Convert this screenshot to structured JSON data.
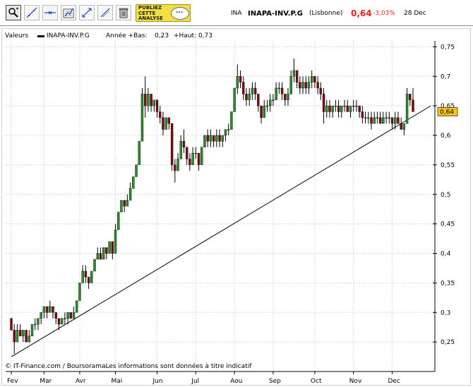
{
  "toolbar": {
    "tools": [
      {
        "name": "zoom-tool-icon",
        "active": true
      },
      {
        "name": "trend-line-tool-icon",
        "active": false
      },
      {
        "name": "horizontal-line-tool-icon",
        "active": false
      },
      {
        "name": "indicator-tool-icon",
        "active": false
      },
      {
        "name": "arrows-tool-icon",
        "active": false
      },
      {
        "name": "fibonacci-tool-icon",
        "active": false
      },
      {
        "name": "trash-tool-icon",
        "active": false
      }
    ],
    "promo": [
      "PUBLIEZ",
      "CETTE",
      "ANALYSE"
    ]
  },
  "quote": {
    "code": "INA",
    "name": "INAPA-INV.P.G",
    "market": "(Lisbonne)",
    "price": "0,64",
    "change": "-3,03%",
    "date": "28 Dec"
  },
  "legend": {
    "caption": "Valeurs",
    "series": "INAPA-INV.P.G",
    "range_label": "Année +Bas:",
    "low": "0,23",
    "high": "+Haut: 0,73"
  },
  "footer": {
    "credit": "© IT-Finance.com / BoursoramaLes informations sont données à titre indicatif"
  },
  "colors": {
    "up": "#2e8b2e",
    "down": "#7a0e0e",
    "wick": "#000000",
    "grid": "#c8c8c8",
    "last_price_box": "#f5c518"
  },
  "chart_data": {
    "type": "candlestick",
    "ylim": [
      0.2,
      0.76
    ],
    "y_ticks": [
      0.25,
      0.3,
      0.35,
      0.4,
      0.45,
      0.5,
      0.55,
      0.6,
      0.65,
      0.7,
      0.75
    ],
    "y_tick_labels": [
      "0,25",
      "0,3",
      "0,35",
      "0,4",
      "0,45",
      "0,5",
      "0,55",
      "0,6",
      "0,65",
      "0,7",
      "0,75"
    ],
    "x_ticks": [
      "Fev",
      "Mar",
      "Avr",
      "Mai",
      "Jun",
      "Jul",
      "Aou",
      "Sep",
      "Oct",
      "Nov",
      "Dec"
    ],
    "x_tick_index": [
      0,
      11,
      23,
      35,
      49,
      62,
      75,
      88,
      102,
      115,
      128
    ],
    "last_price": 0.64,
    "last_price_label": "0,64",
    "grid": true,
    "trend_line": {
      "start_index": 0,
      "start_value": 0.225,
      "end_index": 141,
      "end_value": 0.65
    },
    "candles": [
      [
        0.29,
        0.29,
        0.27,
        0.27
      ],
      [
        0.27,
        0.28,
        0.23,
        0.25
      ],
      [
        0.25,
        0.28,
        0.25,
        0.27
      ],
      [
        0.27,
        0.28,
        0.26,
        0.26
      ],
      [
        0.26,
        0.27,
        0.25,
        0.27
      ],
      [
        0.27,
        0.27,
        0.25,
        0.25
      ],
      [
        0.25,
        0.27,
        0.25,
        0.26
      ],
      [
        0.26,
        0.28,
        0.26,
        0.28
      ],
      [
        0.28,
        0.29,
        0.27,
        0.28
      ],
      [
        0.28,
        0.29,
        0.27,
        0.29
      ],
      [
        0.29,
        0.3,
        0.28,
        0.3
      ],
      [
        0.3,
        0.31,
        0.29,
        0.31
      ],
      [
        0.31,
        0.31,
        0.29,
        0.3
      ],
      [
        0.3,
        0.32,
        0.3,
        0.31
      ],
      [
        0.31,
        0.31,
        0.29,
        0.3
      ],
      [
        0.3,
        0.3,
        0.28,
        0.29
      ],
      [
        0.29,
        0.29,
        0.27,
        0.28
      ],
      [
        0.28,
        0.29,
        0.28,
        0.29
      ],
      [
        0.29,
        0.3,
        0.28,
        0.29
      ],
      [
        0.29,
        0.3,
        0.28,
        0.3
      ],
      [
        0.3,
        0.3,
        0.29,
        0.29
      ],
      [
        0.29,
        0.31,
        0.29,
        0.3
      ],
      [
        0.3,
        0.32,
        0.3,
        0.32
      ],
      [
        0.32,
        0.35,
        0.32,
        0.35
      ],
      [
        0.35,
        0.38,
        0.35,
        0.37
      ],
      [
        0.37,
        0.38,
        0.35,
        0.36
      ],
      [
        0.36,
        0.36,
        0.34,
        0.35
      ],
      [
        0.35,
        0.37,
        0.35,
        0.37
      ],
      [
        0.37,
        0.39,
        0.37,
        0.39
      ],
      [
        0.39,
        0.41,
        0.39,
        0.4
      ],
      [
        0.4,
        0.41,
        0.39,
        0.39
      ],
      [
        0.39,
        0.41,
        0.39,
        0.41
      ],
      [
        0.41,
        0.41,
        0.39,
        0.4
      ],
      [
        0.4,
        0.42,
        0.4,
        0.42
      ],
      [
        0.42,
        0.42,
        0.39,
        0.4
      ],
      [
        0.4,
        0.45,
        0.4,
        0.44
      ],
      [
        0.44,
        0.47,
        0.44,
        0.47
      ],
      [
        0.47,
        0.49,
        0.47,
        0.49
      ],
      [
        0.49,
        0.49,
        0.47,
        0.48
      ],
      [
        0.48,
        0.5,
        0.48,
        0.49
      ],
      [
        0.49,
        0.52,
        0.49,
        0.51
      ],
      [
        0.51,
        0.53,
        0.51,
        0.53
      ],
      [
        0.53,
        0.55,
        0.53,
        0.55
      ],
      [
        0.55,
        0.59,
        0.55,
        0.59
      ],
      [
        0.59,
        0.68,
        0.59,
        0.67
      ],
      [
        0.67,
        0.7,
        0.63,
        0.65
      ],
      [
        0.65,
        0.68,
        0.64,
        0.67
      ],
      [
        0.67,
        0.67,
        0.64,
        0.65
      ],
      [
        0.65,
        0.66,
        0.64,
        0.66
      ],
      [
        0.66,
        0.66,
        0.63,
        0.64
      ],
      [
        0.64,
        0.65,
        0.62,
        0.63
      ],
      [
        0.63,
        0.64,
        0.6,
        0.61
      ],
      [
        0.61,
        0.63,
        0.61,
        0.63
      ],
      [
        0.63,
        0.63,
        0.61,
        0.62
      ],
      [
        0.62,
        0.62,
        0.54,
        0.55
      ],
      [
        0.55,
        0.56,
        0.52,
        0.54
      ],
      [
        0.54,
        0.57,
        0.54,
        0.56
      ],
      [
        0.56,
        0.6,
        0.56,
        0.59
      ],
      [
        0.59,
        0.61,
        0.57,
        0.58
      ],
      [
        0.58,
        0.58,
        0.55,
        0.56
      ],
      [
        0.56,
        0.57,
        0.54,
        0.55
      ],
      [
        0.55,
        0.58,
        0.55,
        0.57
      ],
      [
        0.57,
        0.58,
        0.56,
        0.57
      ],
      [
        0.57,
        0.57,
        0.54,
        0.55
      ],
      [
        0.55,
        0.58,
        0.55,
        0.58
      ],
      [
        0.58,
        0.6,
        0.58,
        0.6
      ],
      [
        0.6,
        0.61,
        0.58,
        0.59
      ],
      [
        0.59,
        0.61,
        0.58,
        0.6
      ],
      [
        0.6,
        0.6,
        0.58,
        0.59
      ],
      [
        0.59,
        0.61,
        0.58,
        0.6
      ],
      [
        0.6,
        0.61,
        0.58,
        0.59
      ],
      [
        0.59,
        0.6,
        0.58,
        0.6
      ],
      [
        0.6,
        0.61,
        0.59,
        0.61
      ],
      [
        0.61,
        0.62,
        0.6,
        0.61
      ],
      [
        0.61,
        0.64,
        0.61,
        0.64
      ],
      [
        0.64,
        0.68,
        0.64,
        0.68
      ],
      [
        0.68,
        0.72,
        0.67,
        0.7
      ],
      [
        0.7,
        0.71,
        0.68,
        0.69
      ],
      [
        0.69,
        0.7,
        0.66,
        0.67
      ],
      [
        0.67,
        0.68,
        0.65,
        0.66
      ],
      [
        0.66,
        0.68,
        0.65,
        0.67
      ],
      [
        0.67,
        0.69,
        0.66,
        0.68
      ],
      [
        0.68,
        0.69,
        0.66,
        0.67
      ],
      [
        0.67,
        0.67,
        0.64,
        0.65
      ],
      [
        0.65,
        0.65,
        0.62,
        0.63
      ],
      [
        0.63,
        0.66,
        0.63,
        0.65
      ],
      [
        0.65,
        0.66,
        0.64,
        0.65
      ],
      [
        0.65,
        0.67,
        0.64,
        0.66
      ],
      [
        0.66,
        0.67,
        0.65,
        0.66
      ],
      [
        0.66,
        0.69,
        0.66,
        0.68
      ],
      [
        0.68,
        0.69,
        0.67,
        0.68
      ],
      [
        0.68,
        0.69,
        0.66,
        0.67
      ],
      [
        0.67,
        0.67,
        0.65,
        0.66
      ],
      [
        0.66,
        0.68,
        0.65,
        0.67
      ],
      [
        0.67,
        0.71,
        0.67,
        0.7
      ],
      [
        0.7,
        0.73,
        0.69,
        0.71
      ],
      [
        0.71,
        0.71,
        0.68,
        0.69
      ],
      [
        0.69,
        0.7,
        0.67,
        0.68
      ],
      [
        0.68,
        0.7,
        0.67,
        0.69
      ],
      [
        0.69,
        0.7,
        0.67,
        0.68
      ],
      [
        0.68,
        0.7,
        0.67,
        0.69
      ],
      [
        0.69,
        0.71,
        0.68,
        0.7
      ],
      [
        0.7,
        0.7,
        0.68,
        0.69
      ],
      [
        0.69,
        0.7,
        0.67,
        0.68
      ],
      [
        0.68,
        0.69,
        0.66,
        0.67
      ],
      [
        0.67,
        0.68,
        0.62,
        0.64
      ],
      [
        0.64,
        0.66,
        0.63,
        0.65
      ],
      [
        0.65,
        0.66,
        0.63,
        0.64
      ],
      [
        0.64,
        0.65,
        0.63,
        0.65
      ],
      [
        0.65,
        0.66,
        0.64,
        0.65
      ],
      [
        0.65,
        0.66,
        0.63,
        0.64
      ],
      [
        0.64,
        0.65,
        0.63,
        0.65
      ],
      [
        0.65,
        0.66,
        0.64,
        0.65
      ],
      [
        0.65,
        0.66,
        0.64,
        0.64
      ],
      [
        0.64,
        0.65,
        0.63,
        0.65
      ],
      [
        0.65,
        0.66,
        0.64,
        0.65
      ],
      [
        0.65,
        0.66,
        0.64,
        0.65
      ],
      [
        0.65,
        0.65,
        0.63,
        0.64
      ],
      [
        0.64,
        0.65,
        0.62,
        0.63
      ],
      [
        0.63,
        0.64,
        0.62,
        0.63
      ],
      [
        0.63,
        0.64,
        0.62,
        0.63
      ],
      [
        0.63,
        0.64,
        0.61,
        0.62
      ],
      [
        0.62,
        0.64,
        0.62,
        0.63
      ],
      [
        0.63,
        0.64,
        0.62,
        0.63
      ],
      [
        0.63,
        0.64,
        0.62,
        0.62
      ],
      [
        0.62,
        0.64,
        0.62,
        0.63
      ],
      [
        0.63,
        0.64,
        0.62,
        0.63
      ],
      [
        0.63,
        0.64,
        0.62,
        0.63
      ],
      [
        0.63,
        0.63,
        0.61,
        0.62
      ],
      [
        0.62,
        0.64,
        0.61,
        0.63
      ],
      [
        0.63,
        0.64,
        0.62,
        0.62
      ],
      [
        0.62,
        0.63,
        0.61,
        0.61
      ],
      [
        0.61,
        0.62,
        0.6,
        0.62
      ],
      [
        0.62,
        0.68,
        0.62,
        0.67
      ],
      [
        0.67,
        0.67,
        0.65,
        0.66
      ],
      [
        0.66,
        0.68,
        0.64,
        0.64
      ]
    ]
  }
}
